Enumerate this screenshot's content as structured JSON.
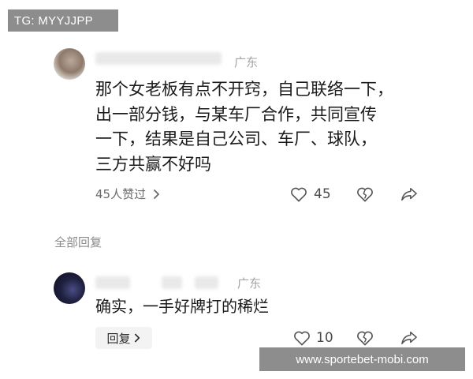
{
  "watermarks": {
    "top": "TG: MYYJJPP",
    "bottom": "www.sportebet-mobi.com"
  },
  "comment": {
    "region": "广东",
    "lines": [
      "那个女老板有点不开窍，自己联络一下，",
      "出一部分钱，与某车厂合作，共同宣传",
      "一下，结果是自己公司、车厂、球队，",
      "三方共赢不好吗"
    ],
    "likes_summary": "45人赞过",
    "like_count": "45"
  },
  "section_label": "全部回复",
  "reply": {
    "region": "广东",
    "text": "确实，一手好牌打的稀烂",
    "reply_button_label": "回复",
    "like_count": "10"
  },
  "icons": {
    "like": "heart-icon",
    "dislike": "broken-heart-icon",
    "share": "share-arrow-icon",
    "chevron": "chevron-right-icon"
  }
}
